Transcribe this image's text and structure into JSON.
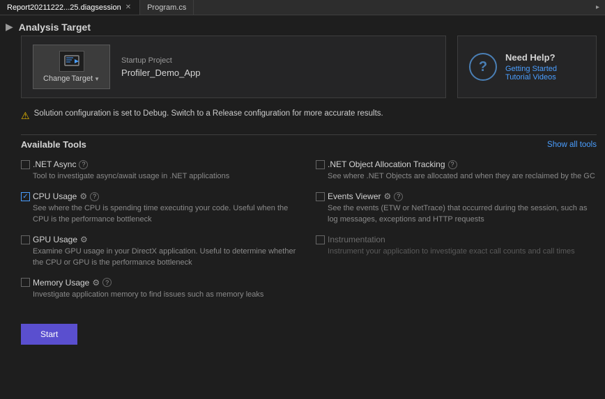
{
  "titlebar": {
    "tabs": [
      {
        "id": "diag",
        "label": "Report20211222...25.diagsession",
        "active": true,
        "closable": true
      },
      {
        "id": "program",
        "label": "Program.cs",
        "active": false,
        "closable": false
      }
    ],
    "scroll_arrow": "▸"
  },
  "section": {
    "title": "Analysis Target"
  },
  "target": {
    "change_button_label": "Change",
    "target_label": "Target",
    "startup_project_label": "Startup Project",
    "startup_project_name": "Profiler_Demo_App"
  },
  "help": {
    "title": "Need Help?",
    "getting_started": "Getting Started",
    "tutorial_videos": "Tutorial Videos"
  },
  "warning": {
    "text": "Solution configuration is set to Debug. Switch to a Release configuration for more accurate results."
  },
  "tools": {
    "section_title": "Available Tools",
    "show_all_label": "Show all tools",
    "items": [
      {
        "id": "dotnet-async",
        "name": ".NET Async",
        "checked": false,
        "has_gear": false,
        "has_info": true,
        "disabled": false,
        "description": "Tool to investigate async/await usage in .NET applications"
      },
      {
        "id": "dotnet-object-allocation",
        "name": ".NET Object Allocation Tracking",
        "checked": false,
        "has_gear": false,
        "has_info": true,
        "disabled": false,
        "description": "See where .NET Objects are allocated and when they are reclaimed by the GC"
      },
      {
        "id": "cpu-usage",
        "name": "CPU Usage",
        "checked": true,
        "has_gear": true,
        "has_info": true,
        "disabled": false,
        "description": "See where the CPU is spending time executing your code. Useful when the CPU is the performance bottleneck"
      },
      {
        "id": "events-viewer",
        "name": "Events Viewer",
        "checked": false,
        "has_gear": true,
        "has_info": true,
        "disabled": false,
        "description": "See the events (ETW or NetTrace) that occurred during the session, such as log messages, exceptions and HTTP requests"
      },
      {
        "id": "gpu-usage",
        "name": "GPU Usage",
        "checked": false,
        "has_gear": true,
        "has_info": false,
        "disabled": false,
        "description": "Examine GPU usage in your DirectX application. Useful to determine whether the CPU or GPU is the performance bottleneck"
      },
      {
        "id": "instrumentation",
        "name": "Instrumentation",
        "checked": false,
        "has_gear": false,
        "has_info": false,
        "disabled": true,
        "description": "Instrument your application to investigate exact call counts and call times"
      },
      {
        "id": "memory-usage",
        "name": "Memory Usage",
        "checked": false,
        "has_gear": true,
        "has_info": true,
        "disabled": false,
        "description": "Investigate application memory to find issues such as memory leaks"
      }
    ]
  },
  "start_button": {
    "label": "Start"
  }
}
